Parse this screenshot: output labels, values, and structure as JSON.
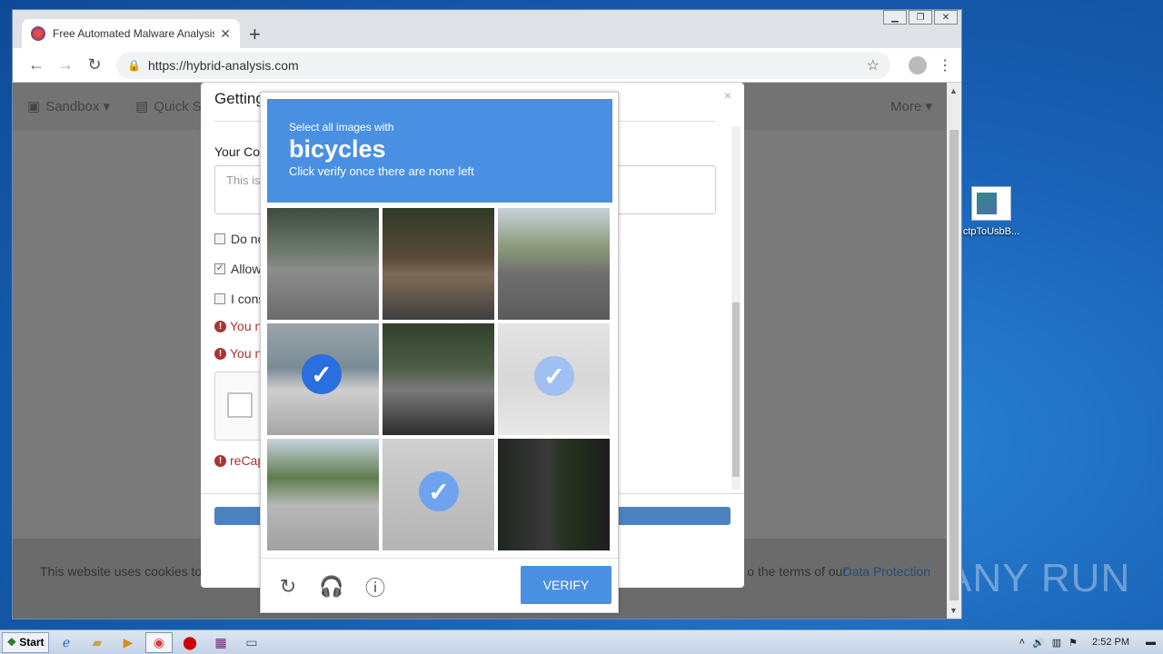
{
  "desktop": {
    "icon_label": "ctpToUsbB...",
    "watermark": "ANY RUN"
  },
  "browser": {
    "tab_title": "Free Automated Malware Analysis S",
    "tab_close": "✕",
    "new_tab": "+",
    "url": "https://hybrid-analysis.com"
  },
  "site": {
    "nav": [
      {
        "label": "Sandbox ▾",
        "icon": "cube-icon"
      },
      {
        "label": "Quick S",
        "icon": "file-icon"
      }
    ],
    "more": "More ▾",
    "cookie_text": "This website uses cookies to",
    "cookie_tail": "o the terms of our",
    "cookie_link": "Data Protection"
  },
  "modal": {
    "title": "Getting Things Ready",
    "close": "×",
    "comment_label": "Your Con",
    "comment_placeholder": "This is",
    "checkbox1": "Do no",
    "checkbox2": "Allow",
    "checkbox3": "I cons",
    "error1": "You n",
    "error2": "You n",
    "error3": "reCap"
  },
  "captcha": {
    "instruction": "Select all images with",
    "target": "bicycles",
    "hint": "Click verify once there are none left",
    "verify": "VERIFY",
    "tiles": [
      {
        "scene": "street-corner",
        "selected": false
      },
      {
        "scene": "house-driveway",
        "selected": false
      },
      {
        "scene": "road-car",
        "selected": false
      },
      {
        "scene": "sidewalk-store",
        "selected": true
      },
      {
        "scene": "intersection",
        "selected": false
      },
      {
        "scene": "cyclist-road",
        "selected": true,
        "faded": true
      },
      {
        "scene": "parking-lot",
        "selected": false
      },
      {
        "scene": "bike-rack",
        "selected": true,
        "faded": true
      },
      {
        "scene": "sign-pole",
        "selected": false
      }
    ]
  },
  "taskbar": {
    "start": "Start",
    "clock": "2:52 PM"
  }
}
